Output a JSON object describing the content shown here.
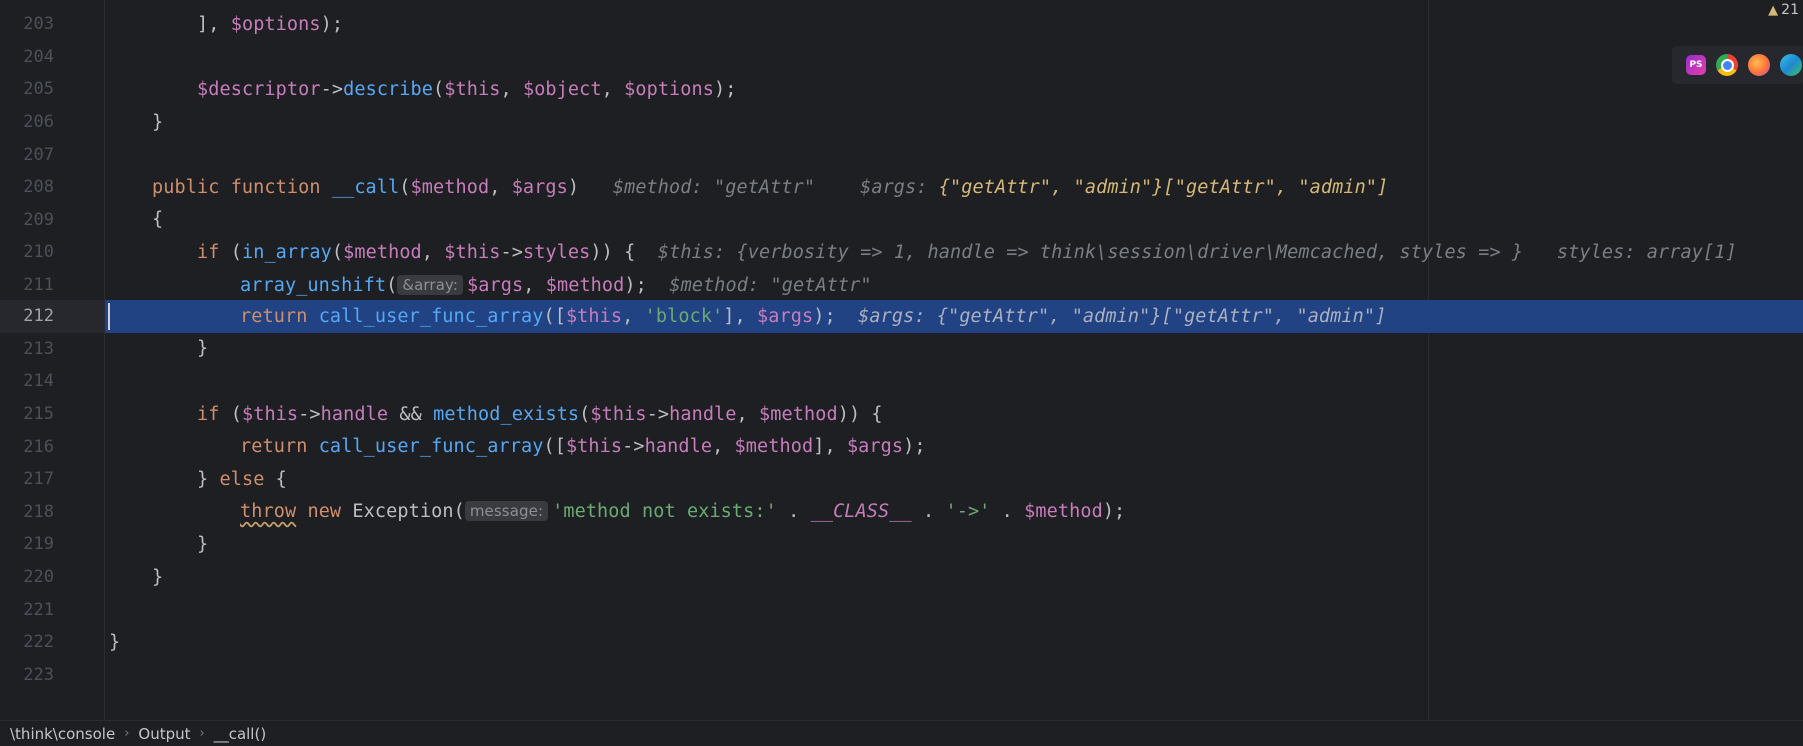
{
  "editor": {
    "active_line": 212,
    "warnings_count": "21",
    "lines": [
      {
        "n": "203"
      },
      {
        "n": "204"
      },
      {
        "n": "205"
      },
      {
        "n": "206"
      },
      {
        "n": "207"
      },
      {
        "n": "208"
      },
      {
        "n": "209"
      },
      {
        "n": "210"
      },
      {
        "n": "211"
      },
      {
        "n": "212"
      },
      {
        "n": "213"
      },
      {
        "n": "214"
      },
      {
        "n": "215"
      },
      {
        "n": "216"
      },
      {
        "n": "217"
      },
      {
        "n": "218"
      },
      {
        "n": "219"
      },
      {
        "n": "220"
      },
      {
        "n": "221"
      },
      {
        "n": "222"
      },
      {
        "n": "223"
      }
    ],
    "code": {
      "l203": {
        "a": "], ",
        "b": "$options",
        "c": ");"
      },
      "l205": {
        "a": "$descriptor",
        "b": "->",
        "c": "describe",
        "d": "(",
        "e": "$this",
        "f": ", ",
        "g": "$object",
        "h": ", ",
        "i": "$options",
        "j": ");"
      },
      "l206": "}",
      "l208": {
        "kw1": "public",
        "kw2": "function",
        "fn": "__call",
        "p1": "$method",
        "p2": "$args",
        "hint1": "$method: \"getAttr\"",
        "hint2": "$args: ",
        "hint2val": "{\"getAttr\", \"admin\"}[\"getAttr\", \"admin\"]"
      },
      "l209": "{",
      "l210": {
        "kw": "if",
        "fn": "in_array",
        "v1": "$method",
        "v2": "$this",
        "prop": "styles",
        "hint1": "$this: {verbosity => 1, handle => think\\session\\driver\\Memcached, styles => }",
        "hint2": "styles: array[1]"
      },
      "l211": {
        "fn": "array_unshift",
        "param": "&array:",
        "v1": "$args",
        "v2": "$method",
        "hint": "$method: \"getAttr\""
      },
      "l212": {
        "kw": "return",
        "fn": "call_user_func_array",
        "v1": "$this",
        "s1": "'block'",
        "v2": "$args",
        "hint": "$args: {\"getAttr\", \"admin\"}[\"getAttr\", \"admin\"]"
      },
      "l213": "}",
      "l215": {
        "kw": "if",
        "v1": "$this",
        "p1": "handle",
        "op": "&&",
        "fn": "method_exists",
        "v2": "$this",
        "p2": "handle",
        "v3": "$method"
      },
      "l216": {
        "kw": "return",
        "fn": "call_user_func_array",
        "v1": "$this",
        "p1": "handle",
        "v2": "$method",
        "v3": "$args"
      },
      "l217": {
        "a": "} ",
        "kw": "else",
        "b": " {"
      },
      "l218": {
        "kw1": "throw",
        "kw2": "new",
        "cls": "Exception",
        "param": "message:",
        "s1": "'method not exists:'",
        "c": "__CLASS__",
        "s2": "'->'",
        "v": "$method"
      },
      "l219": "}",
      "l220": "}",
      "l222": "}"
    }
  },
  "breadcrumb": {
    "items": [
      "\\think\\console",
      "Output",
      "__call()"
    ]
  },
  "toolbar": {
    "browsers": [
      "phpstorm-icon",
      "chrome-icon",
      "firefox-icon",
      "edge-icon"
    ]
  }
}
